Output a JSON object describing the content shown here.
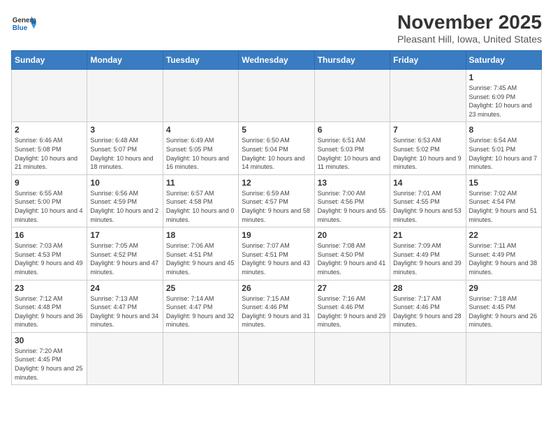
{
  "header": {
    "logo_line1": "General",
    "logo_line2": "Blue",
    "title": "November 2025",
    "subtitle": "Pleasant Hill, Iowa, United States"
  },
  "days_of_week": [
    "Sunday",
    "Monday",
    "Tuesday",
    "Wednesday",
    "Thursday",
    "Friday",
    "Saturday"
  ],
  "weeks": [
    [
      {
        "day": "",
        "info": ""
      },
      {
        "day": "",
        "info": ""
      },
      {
        "day": "",
        "info": ""
      },
      {
        "day": "",
        "info": ""
      },
      {
        "day": "",
        "info": ""
      },
      {
        "day": "",
        "info": ""
      },
      {
        "day": "1",
        "info": "Sunrise: 7:45 AM\nSunset: 6:09 PM\nDaylight: 10 hours and 23 minutes."
      }
    ],
    [
      {
        "day": "2",
        "info": "Sunrise: 6:46 AM\nSunset: 5:08 PM\nDaylight: 10 hours and 21 minutes."
      },
      {
        "day": "3",
        "info": "Sunrise: 6:48 AM\nSunset: 5:07 PM\nDaylight: 10 hours and 18 minutes."
      },
      {
        "day": "4",
        "info": "Sunrise: 6:49 AM\nSunset: 5:05 PM\nDaylight: 10 hours and 16 minutes."
      },
      {
        "day": "5",
        "info": "Sunrise: 6:50 AM\nSunset: 5:04 PM\nDaylight: 10 hours and 14 minutes."
      },
      {
        "day": "6",
        "info": "Sunrise: 6:51 AM\nSunset: 5:03 PM\nDaylight: 10 hours and 11 minutes."
      },
      {
        "day": "7",
        "info": "Sunrise: 6:53 AM\nSunset: 5:02 PM\nDaylight: 10 hours and 9 minutes."
      },
      {
        "day": "8",
        "info": "Sunrise: 6:54 AM\nSunset: 5:01 PM\nDaylight: 10 hours and 7 minutes."
      }
    ],
    [
      {
        "day": "9",
        "info": "Sunrise: 6:55 AM\nSunset: 5:00 PM\nDaylight: 10 hours and 4 minutes."
      },
      {
        "day": "10",
        "info": "Sunrise: 6:56 AM\nSunset: 4:59 PM\nDaylight: 10 hours and 2 minutes."
      },
      {
        "day": "11",
        "info": "Sunrise: 6:57 AM\nSunset: 4:58 PM\nDaylight: 10 hours and 0 minutes."
      },
      {
        "day": "12",
        "info": "Sunrise: 6:59 AM\nSunset: 4:57 PM\nDaylight: 9 hours and 58 minutes."
      },
      {
        "day": "13",
        "info": "Sunrise: 7:00 AM\nSunset: 4:56 PM\nDaylight: 9 hours and 55 minutes."
      },
      {
        "day": "14",
        "info": "Sunrise: 7:01 AM\nSunset: 4:55 PM\nDaylight: 9 hours and 53 minutes."
      },
      {
        "day": "15",
        "info": "Sunrise: 7:02 AM\nSunset: 4:54 PM\nDaylight: 9 hours and 51 minutes."
      }
    ],
    [
      {
        "day": "16",
        "info": "Sunrise: 7:03 AM\nSunset: 4:53 PM\nDaylight: 9 hours and 49 minutes."
      },
      {
        "day": "17",
        "info": "Sunrise: 7:05 AM\nSunset: 4:52 PM\nDaylight: 9 hours and 47 minutes."
      },
      {
        "day": "18",
        "info": "Sunrise: 7:06 AM\nSunset: 4:51 PM\nDaylight: 9 hours and 45 minutes."
      },
      {
        "day": "19",
        "info": "Sunrise: 7:07 AM\nSunset: 4:51 PM\nDaylight: 9 hours and 43 minutes."
      },
      {
        "day": "20",
        "info": "Sunrise: 7:08 AM\nSunset: 4:50 PM\nDaylight: 9 hours and 41 minutes."
      },
      {
        "day": "21",
        "info": "Sunrise: 7:09 AM\nSunset: 4:49 PM\nDaylight: 9 hours and 39 minutes."
      },
      {
        "day": "22",
        "info": "Sunrise: 7:11 AM\nSunset: 4:49 PM\nDaylight: 9 hours and 38 minutes."
      }
    ],
    [
      {
        "day": "23",
        "info": "Sunrise: 7:12 AM\nSunset: 4:48 PM\nDaylight: 9 hours and 36 minutes."
      },
      {
        "day": "24",
        "info": "Sunrise: 7:13 AM\nSunset: 4:47 PM\nDaylight: 9 hours and 34 minutes."
      },
      {
        "day": "25",
        "info": "Sunrise: 7:14 AM\nSunset: 4:47 PM\nDaylight: 9 hours and 32 minutes."
      },
      {
        "day": "26",
        "info": "Sunrise: 7:15 AM\nSunset: 4:46 PM\nDaylight: 9 hours and 31 minutes."
      },
      {
        "day": "27",
        "info": "Sunrise: 7:16 AM\nSunset: 4:46 PM\nDaylight: 9 hours and 29 minutes."
      },
      {
        "day": "28",
        "info": "Sunrise: 7:17 AM\nSunset: 4:46 PM\nDaylight: 9 hours and 28 minutes."
      },
      {
        "day": "29",
        "info": "Sunrise: 7:18 AM\nSunset: 4:45 PM\nDaylight: 9 hours and 26 minutes."
      }
    ],
    [
      {
        "day": "30",
        "info": "Sunrise: 7:20 AM\nSunset: 4:45 PM\nDaylight: 9 hours and 25 minutes."
      },
      {
        "day": "",
        "info": ""
      },
      {
        "day": "",
        "info": ""
      },
      {
        "day": "",
        "info": ""
      },
      {
        "day": "",
        "info": ""
      },
      {
        "day": "",
        "info": ""
      },
      {
        "day": "",
        "info": ""
      }
    ]
  ]
}
